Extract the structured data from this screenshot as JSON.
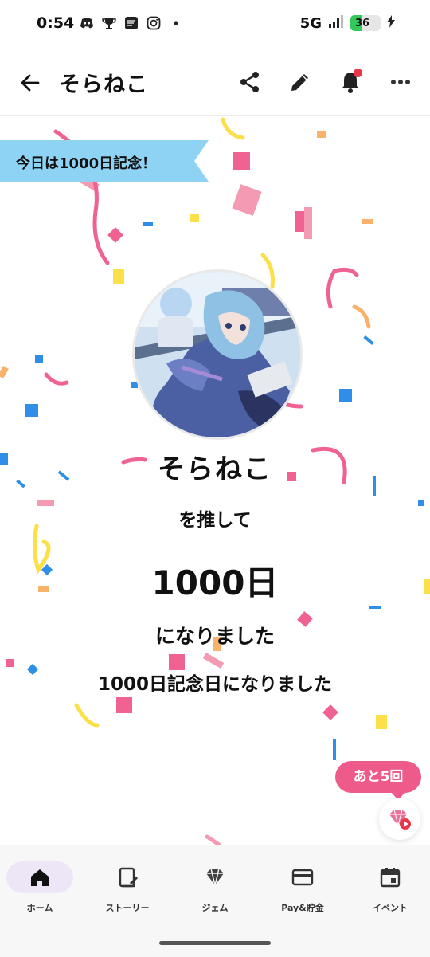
{
  "status_bar": {
    "time": "0:54",
    "network": "5G",
    "battery": "36",
    "battery_level": 0.36,
    "icons": [
      "discord-icon",
      "trophy-icon",
      "app-icon",
      "instagram-icon",
      "dot-icon",
      "signal-icon",
      "charging-icon"
    ]
  },
  "header": {
    "title": "そらねこ",
    "icons": [
      "back-arrow-icon",
      "share-icon",
      "edit-pencil-icon",
      "notification-bell-icon",
      "more-icon"
    ],
    "notification_dot_color": "#e8364a"
  },
  "main": {
    "ribbon": "今日は1000日記念！",
    "oshi_name": "そらねこ",
    "line1": "を推して",
    "days": "1000日",
    "line2": "になりました",
    "line3": "1000日記念日になりました",
    "remaining_bubble": "あと5回",
    "fab_icon": "gem-play-icon"
  },
  "nav": {
    "items": [
      {
        "label": "ホーム",
        "icon": "home-icon",
        "active": true
      },
      {
        "label": "ストーリー",
        "icon": "story-icon",
        "active": false
      },
      {
        "label": "ジェム",
        "icon": "gem-icon",
        "active": false
      },
      {
        "label": "Pay&貯金",
        "icon": "card-icon",
        "active": false
      },
      {
        "label": "イベント",
        "icon": "calendar-icon",
        "active": false
      }
    ]
  },
  "colors": {
    "accent_pink": "#ee5a8a",
    "ribbon_blue": "#8fd3f4",
    "confetti": [
      "#f06292",
      "#2f8fe8",
      "#fbe04a",
      "#f9b26b"
    ],
    "active_nav": "#ece6f7"
  }
}
